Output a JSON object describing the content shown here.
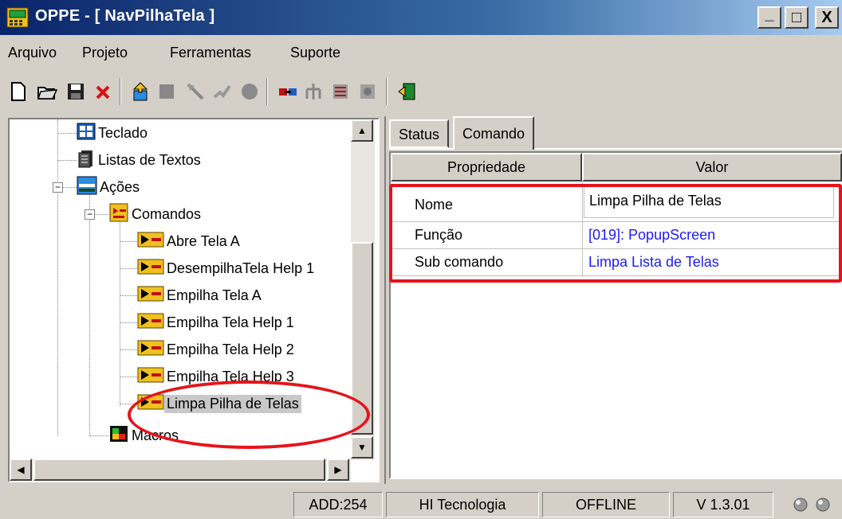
{
  "window": {
    "title": "OPPE - [ NavPilhaTela ]",
    "controls": {
      "minimize": "_",
      "maximize": "□",
      "close": "X"
    }
  },
  "menu": {
    "items": [
      {
        "label": "Arquivo"
      },
      {
        "label": "Projeto"
      },
      {
        "label": "Ferramentas"
      },
      {
        "label": "Suporte"
      }
    ]
  },
  "toolbar": {
    "buttons": [
      "new-file-icon",
      "open-folder-icon",
      "save-icon",
      "delete-icon",
      "import-icon",
      "block-icon",
      "wand-icon",
      "connect-icon",
      "record-icon",
      "link-icon",
      "tree-icon",
      "debug-icon",
      "settings-icon",
      "exit-icon"
    ]
  },
  "tree": {
    "items": [
      {
        "label": "Teclado",
        "icon": "keyboard-icon"
      },
      {
        "label": "Listas de Textos",
        "icon": "text-list-icon"
      },
      {
        "label": "Ações",
        "icon": "actions-icon",
        "expander": "−"
      },
      {
        "label": "Comandos",
        "icon": "commands-icon",
        "expander": "−"
      },
      {
        "label": "Abre Tela A",
        "icon": "command-icon"
      },
      {
        "label": "DesempilhaTela Help 1",
        "icon": "command-icon"
      },
      {
        "label": "Empilha Tela A",
        "icon": "command-icon"
      },
      {
        "label": "Empilha Tela Help 1",
        "icon": "command-icon"
      },
      {
        "label": "Empilha Tela Help 2",
        "icon": "command-icon"
      },
      {
        "label": "Empilha Tela Help 3",
        "icon": "command-icon"
      },
      {
        "label": "Limpa Pilha de Telas",
        "icon": "command-icon",
        "selected": true
      },
      {
        "label": "Macros",
        "icon": "macros-icon"
      }
    ],
    "scroll_up": "▲",
    "scroll_down": "▼",
    "scroll_left": "◀",
    "scroll_right": "▶"
  },
  "tabs": {
    "items": [
      {
        "label": "Status",
        "active": false
      },
      {
        "label": "Comando",
        "active": true
      }
    ]
  },
  "properties": {
    "headers": {
      "name": "Propriedade",
      "value": "Valor"
    },
    "rows": [
      {
        "name": "Nome",
        "value": "Limpa Pilha de Telas",
        "color": "#000000"
      },
      {
        "name": "Função",
        "value": "[019]: PopupScreen",
        "color": "#1a1aff"
      },
      {
        "name": "Sub comando",
        "value": "Limpa Lista de Telas",
        "color": "#1a1aff"
      }
    ]
  },
  "status_bar": {
    "address": "ADD:254",
    "company": "HI Tecnologia",
    "connection": "OFFLINE",
    "version": "V 1.3.01"
  },
  "colors": {
    "annotation": "#e8121a",
    "link_value": "#1a1aff",
    "titlebar_start": "#0a246a"
  }
}
